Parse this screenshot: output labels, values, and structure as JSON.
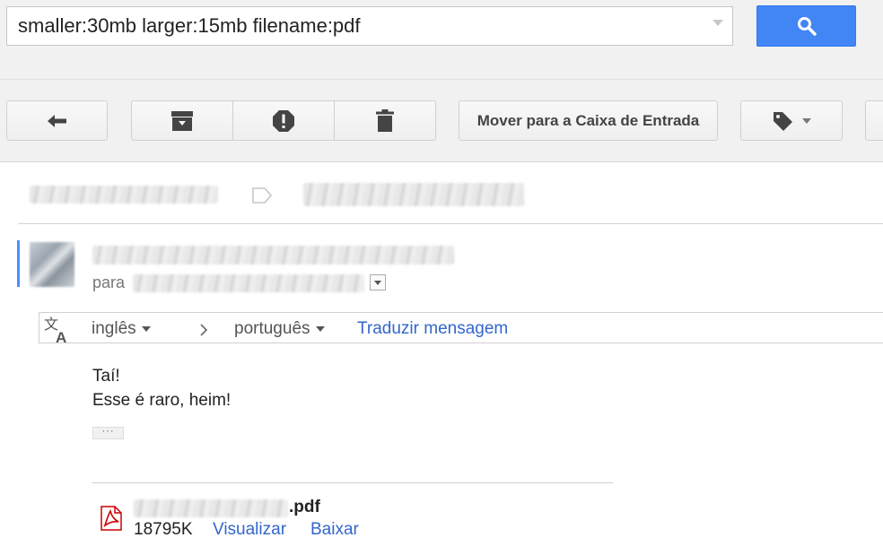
{
  "search": {
    "query": "smaller:30mb larger:15mb filename:pdf"
  },
  "icons": {
    "search": "search-icon",
    "reply": "reply-arrow-icon",
    "archive": "archive-icon",
    "spam": "report-spam-icon",
    "delete": "trash-icon",
    "labels": "label-tag-icon",
    "translate": "translate-icon",
    "pdf": "pdf-file-icon"
  },
  "toolbar": {
    "move_to_inbox_label": "Mover para a Caixa de Entrada"
  },
  "message": {
    "to_label": "para",
    "translate": {
      "source_language": "inglês",
      "target_language": "português",
      "action_label": "Traduzir mensagem"
    },
    "body": [
      "Taí!",
      "Esse é raro, heim!"
    ],
    "attachment": {
      "name_suffix": ".pdf",
      "size": "18795K",
      "view_label": "Visualizar",
      "download_label": "Baixar"
    }
  },
  "colors": {
    "search_button": "#4285f4",
    "link": "#3366cc",
    "selected_bar": "#4d90fe"
  }
}
